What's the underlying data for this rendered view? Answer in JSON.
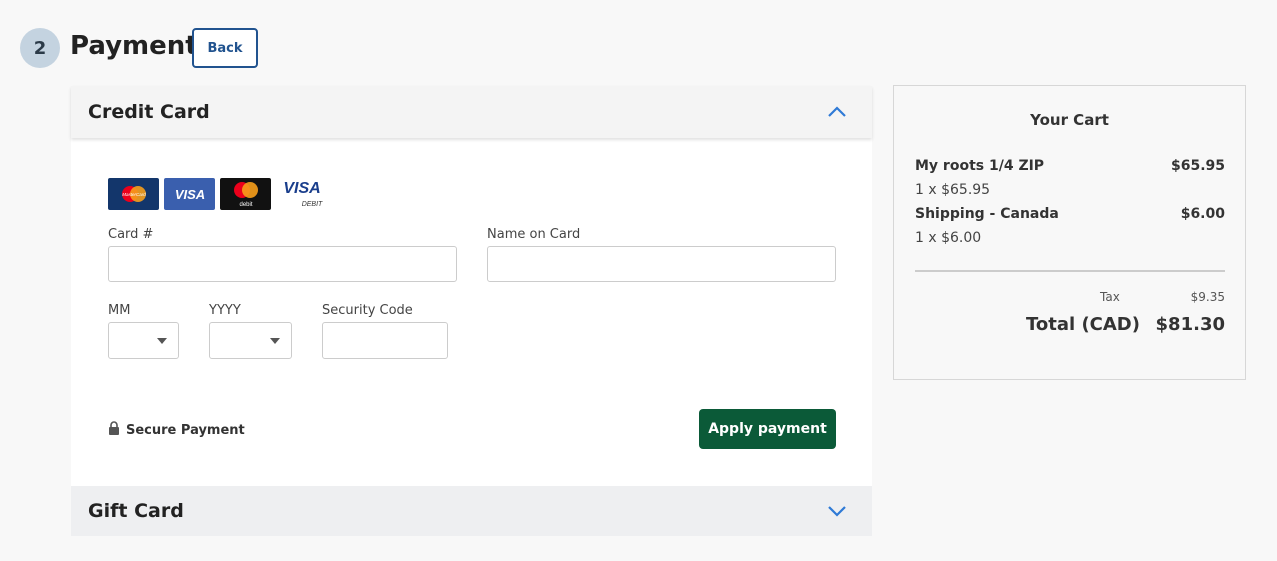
{
  "step": {
    "number": "2",
    "title": "Payment",
    "back_label": "Back"
  },
  "credit_card": {
    "title": "Credit Card",
    "logos": [
      "mastercard-logo",
      "visa-logo",
      "mastercard-debit-logo",
      "visa-debit-logo"
    ],
    "logo_text": {
      "visa": "VISA",
      "visa_debit": "VISA",
      "debit": "DEBIT",
      "mastercard": "MasterCard",
      "mastercard_debit": "debit"
    },
    "card_number_label": "Card #",
    "name_on_card_label": "Name on Card",
    "month_label": "MM",
    "year_label": "YYYY",
    "security_code_label": "Security Code",
    "secure_text": "Secure Payment",
    "apply_label": "Apply payment",
    "expanded": true
  },
  "gift_card": {
    "title": "Gift Card",
    "expanded": false
  },
  "cart": {
    "title": "Your Cart",
    "items": [
      {
        "name": "My roots 1/4 ZIP",
        "price": "$65.95",
        "qty": "1 x $65.95"
      },
      {
        "name": "Shipping - Canada",
        "price": "$6.00",
        "qty": "1 x $6.00"
      }
    ],
    "tax_label": "Tax",
    "tax_value": "$9.35",
    "total_label": "Total (CAD)",
    "total_value": "$81.30"
  },
  "colors": {
    "accent": "#21538f",
    "apply": "#0b5a38",
    "chevron": "#2f7ad6"
  }
}
